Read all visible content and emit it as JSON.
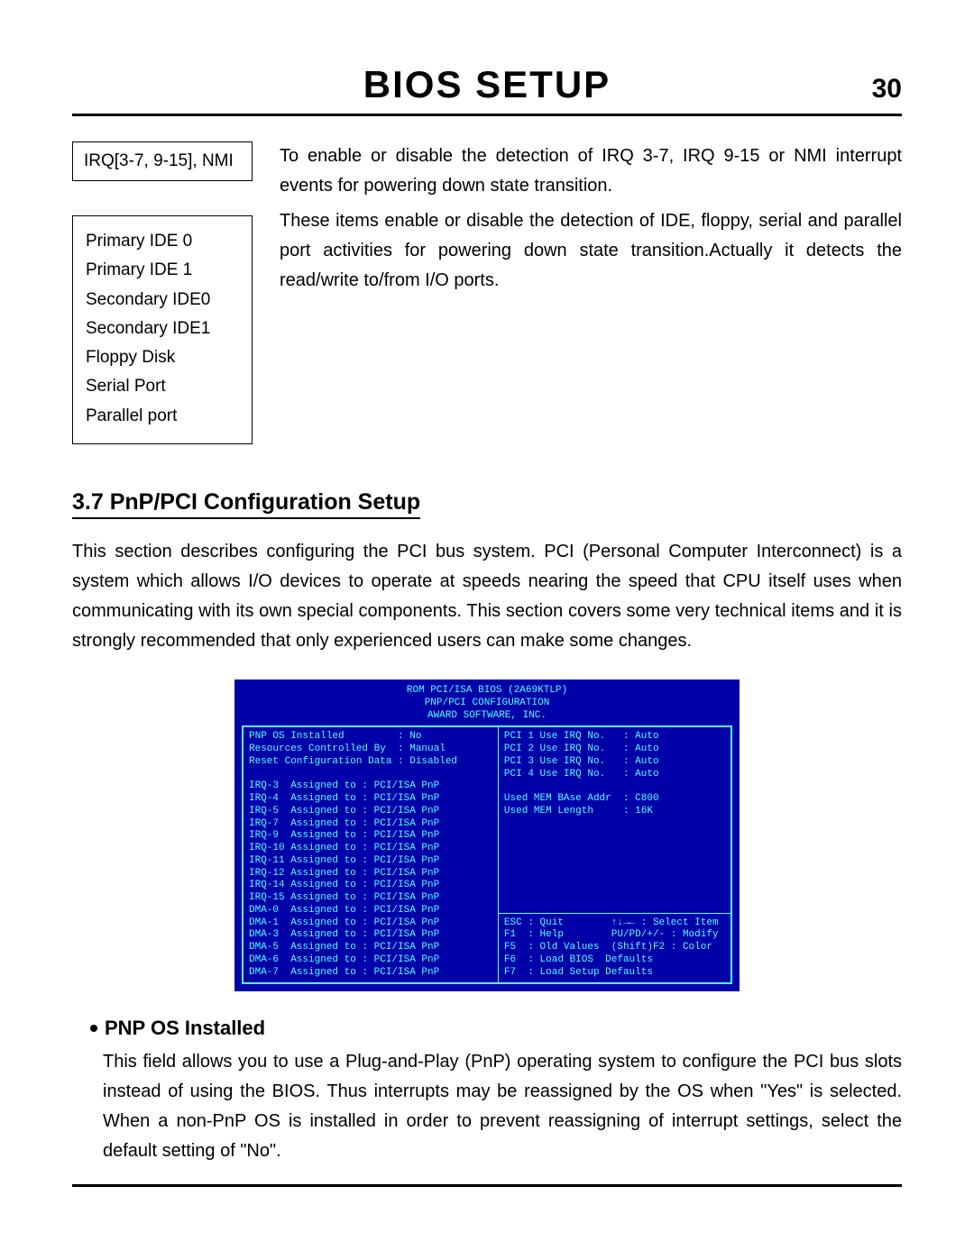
{
  "header": {
    "title": "BIOS SETUP",
    "page_num": "30"
  },
  "box_irq": "IRQ[3-7, 9-15], NMI",
  "box_list": {
    "l1": "Primary IDE 0",
    "l2": "Primary IDE 1",
    "l3": "Secondary IDE0",
    "l4": "Secondary IDE1",
    "l5": "Floppy Disk",
    "l6": "Serial Port",
    "l7": "Parallel port"
  },
  "para_irq": "To enable or disable the detection of IRQ 3-7, IRQ 9-15 or NMI interrupt events for powering down state transition.",
  "para_ide": "These items enable or disable the detection of IDE, floppy, serial and parallel port activities for powering down state transition.Actually it detects the read/write to/from I/O ports.",
  "section_37": "3.7 PnP/PCI Configuration Setup",
  "section_37_text": "This section describes configuring the PCI bus system.  PCI (Personal Computer Interconnect) is a system which allows I/O devices to operate at speeds nearing the speed that CPU itself uses when communicating with its own special components.  This section covers some very technical items and it is strongly recommended that only experienced users can make some changes.",
  "bios": {
    "head1": "ROM PCI/ISA BIOS (2A69KTLP)",
    "head2": "PNP/PCI CONFIGURATION",
    "head3": "AWARD SOFTWARE, INC.",
    "left": "PNP OS Installed         : No\nResources Controlled By  : Manual\nReset Configuration Data : Disabled\n\nIRQ-3  Assigned to : PCI/ISA PnP\nIRQ-4  Assigned to : PCI/ISA PnP\nIRQ-5  Assigned to : PCI/ISA PnP\nIRQ-7  Assigned to : PCI/ISA PnP\nIRQ-9  Assigned to : PCI/ISA PnP\nIRQ-10 Assigned to : PCI/ISA PnP\nIRQ-11 Assigned to : PCI/ISA PnP\nIRQ-12 Assigned to : PCI/ISA PnP\nIRQ-14 Assigned to : PCI/ISA PnP\nIRQ-15 Assigned to : PCI/ISA PnP\nDMA-0  Assigned to : PCI/ISA PnP\nDMA-1  Assigned to : PCI/ISA PnP\nDMA-3  Assigned to : PCI/ISA PnP\nDMA-5  Assigned to : PCI/ISA PnP\nDMA-6  Assigned to : PCI/ISA PnP\nDMA-7  Assigned to : PCI/ISA PnP",
    "right_top": "PCI 1 Use IRQ No.   : Auto\nPCI 2 Use IRQ No.   : Auto\nPCI 3 Use IRQ No.   : Auto\nPCI 4 Use IRQ No.   : Auto\n\nUsed MEM BAse Addr  : C800\nUsed MEM Length     : 16K",
    "right_bottom": "ESC : Quit        ↑↓→← : Select Item\nF1  : Help        PU/PD/+/- : Modify\nF5  : Old Values  (Shift)F2 : Color\nF6  : Load BIOS  Defaults\nF7  : Load Setup Defaults"
  },
  "sub_pnp_title": "PNP OS Installed",
  "sub_pnp_text": "This field allows you to use a Plug-and-Play (PnP) operating system to configure the PCI bus slots instead of using the BIOS. Thus interrupts may be reassigned by the OS when \"Yes\"  is selected. When a non-PnP OS is installed in order to prevent reassigning of interrupt settings, select the default setting of \"No\"."
}
